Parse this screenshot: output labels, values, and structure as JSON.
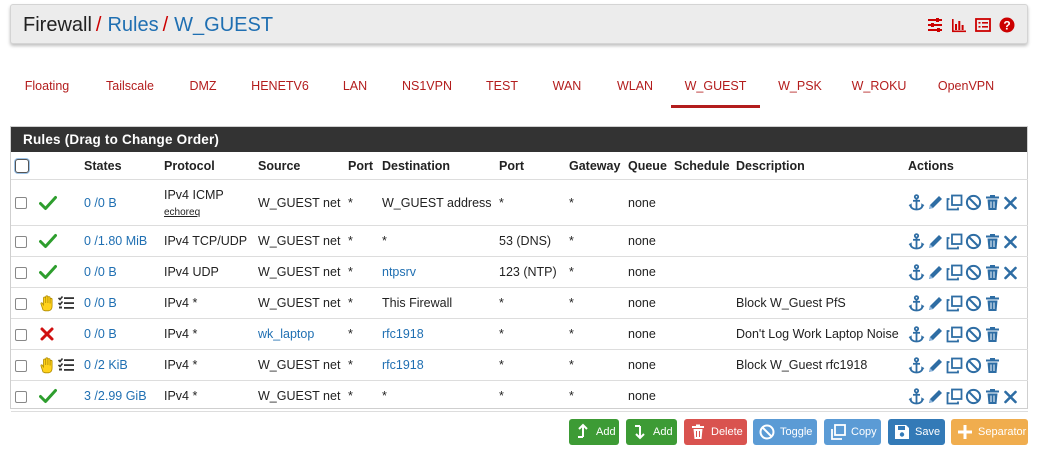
{
  "breadcrumb": {
    "root": "Firewall",
    "rules": "Rules",
    "current": "W_GUEST",
    "separator": "/"
  },
  "header_icons": [
    "sliders-icon",
    "bar-chart-icon",
    "list-icon",
    "help-icon"
  ],
  "tabs": [
    {
      "label": "Floating"
    },
    {
      "label": "Tailscale"
    },
    {
      "label": "DMZ"
    },
    {
      "label": "HENETV6"
    },
    {
      "label": "LAN"
    },
    {
      "label": "NS1VPN"
    },
    {
      "label": "TEST"
    },
    {
      "label": "WAN"
    },
    {
      "label": "WLAN"
    },
    {
      "label": "W_GUEST",
      "active": true
    },
    {
      "label": "W_PSK"
    },
    {
      "label": "W_ROKU"
    },
    {
      "label": "OpenVPN"
    }
  ],
  "panel": {
    "title": "Rules (Drag to Change Order)"
  },
  "columns": {
    "states": "States",
    "protocol": "Protocol",
    "source": "Source",
    "port": "Port",
    "destination": "Destination",
    "dport": "Port",
    "gateway": "Gateway",
    "queue": "Queue",
    "schedule": "Schedule",
    "description": "Description",
    "actions": "Actions"
  },
  "rules": [
    {
      "status": "pass",
      "states": "0 /0 B",
      "protocol": "IPv4 ICMP",
      "protocol_sub": "echoreq",
      "source": "W_GUEST net",
      "port": "*",
      "destination": "W_GUEST address",
      "dport": "*",
      "gateway": "*",
      "queue": "none",
      "schedule": "",
      "description": ""
    },
    {
      "status": "pass",
      "states": "0 /1.80 MiB",
      "protocol": "IPv4 TCP/UDP",
      "source": "W_GUEST net",
      "port": "*",
      "destination": "*",
      "dport": "53 (DNS)",
      "gateway": "*",
      "queue": "none",
      "schedule": "",
      "description": ""
    },
    {
      "status": "pass",
      "states": "0 /0 B",
      "protocol": "IPv4 UDP",
      "source": "W_GUEST net",
      "port": "*",
      "destination": "ntpsrv",
      "destination_link": true,
      "dport": "123 (NTP)",
      "gateway": "*",
      "queue": "none",
      "schedule": "",
      "description": ""
    },
    {
      "status": "block-log",
      "states": "0 /0 B",
      "protocol": "IPv4 *",
      "source": "W_GUEST net",
      "port": "*",
      "destination": "This Firewall",
      "dport": "*",
      "gateway": "*",
      "queue": "none",
      "schedule": "",
      "description": "Block W_Guest PfS"
    },
    {
      "status": "block",
      "states": "0 /0 B",
      "protocol": "IPv4 *",
      "source": "wk_laptop",
      "source_link": true,
      "port": "*",
      "destination": "rfc1918",
      "destination_link": true,
      "dport": "*",
      "gateway": "*",
      "queue": "none",
      "schedule": "",
      "description": "Don't Log Work Laptop Noise"
    },
    {
      "status": "block-log",
      "states": "0 /2 KiB",
      "protocol": "IPv4 *",
      "source": "W_GUEST net",
      "port": "*",
      "destination": "rfc1918",
      "destination_link": true,
      "dport": "*",
      "gateway": "*",
      "queue": "none",
      "schedule": "",
      "description": "Block W_Guest rfc1918"
    },
    {
      "status": "pass",
      "states": "3 /2.99 GiB",
      "protocol": "IPv4 *",
      "source": "W_GUEST net",
      "port": "*",
      "destination": "*",
      "dport": "*",
      "gateway": "*",
      "queue": "none",
      "schedule": "",
      "description": ""
    }
  ],
  "buttons": {
    "add_top": "Add",
    "add_bottom": "Add",
    "delete": "Delete",
    "toggle": "Toggle",
    "copy": "Copy",
    "save": "Save",
    "separator": "Separator"
  },
  "colors": {
    "accent_red": "#b31d1d",
    "link_blue": "#1f6fb2",
    "pass_green": "#2e9e2e",
    "block_red": "#d01010",
    "btn_green": "#3d9b35",
    "btn_red": "#d9534f",
    "btn_info": "#5b9bd5",
    "btn_blue": "#337ab7",
    "btn_orange": "#f0ad4e"
  }
}
